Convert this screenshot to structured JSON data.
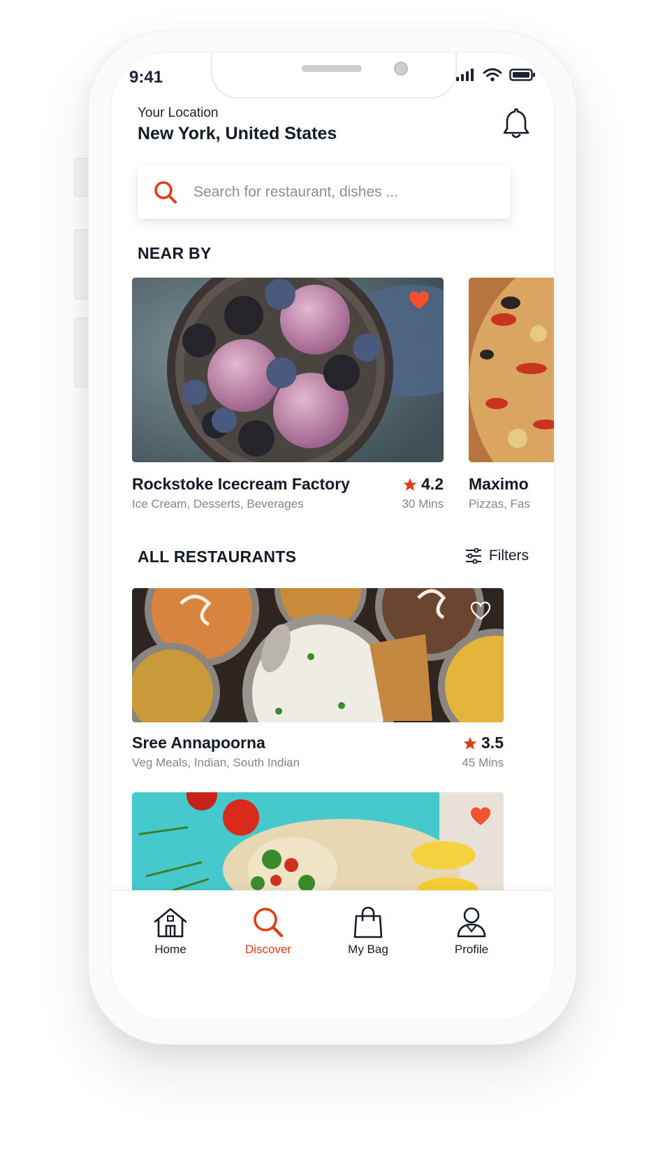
{
  "status_bar": {
    "time": "9:41"
  },
  "header": {
    "location_caption": "Your Location",
    "location_value": "New York, United States"
  },
  "search": {
    "placeholder": "Search for restaurant, dishes ..."
  },
  "nearby": {
    "title": "NEAR BY",
    "cards": [
      {
        "name": "Rockstoke Icecream Factory",
        "cuisines": "Ice Cream, Desserts, Beverages",
        "rating": "4.2",
        "eta": "30 Mins",
        "favorite": true
      },
      {
        "name": "Maximo",
        "cuisines": "Pizzas, Fas",
        "favorite": false
      }
    ]
  },
  "all_restaurants": {
    "title": "ALL RESTAURANTS",
    "filters_label": "Filters",
    "items": [
      {
        "name": "Sree Annapoorna",
        "cuisines": "Veg Meals, Indian, South Indian",
        "rating": "3.5",
        "eta": "45 Mins",
        "favorite": false
      },
      {
        "favorite": true
      }
    ]
  },
  "bottom_nav": {
    "items": [
      {
        "label": "Home",
        "icon": "home-icon"
      },
      {
        "label": "Discover",
        "icon": "search-icon",
        "active": true
      },
      {
        "label": "My Bag",
        "icon": "bag-icon"
      },
      {
        "label": "Profile",
        "icon": "profile-icon"
      }
    ]
  },
  "colors": {
    "accent": "#e13d15",
    "heart": "#f4512c",
    "text_primary": "#141a26",
    "text_secondary": "#858585"
  }
}
